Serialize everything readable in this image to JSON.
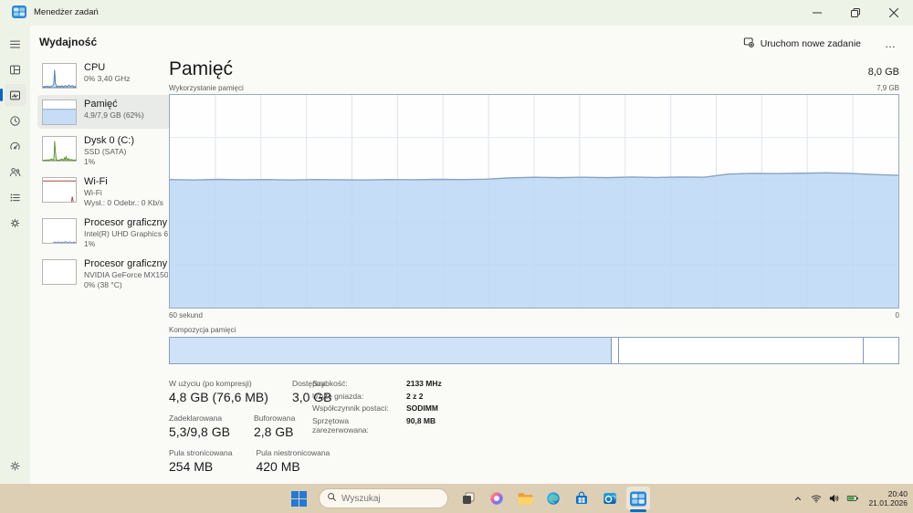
{
  "window": {
    "title": "Menedżer zadań"
  },
  "header": {
    "page_title": "Wydajność",
    "run_task_label": "Uruchom nowe zadanie",
    "more_label": "…"
  },
  "nav_rail": [
    "menu",
    "processes",
    "performance",
    "app-history",
    "startup-apps",
    "users",
    "details",
    "services",
    "settings"
  ],
  "sidebar": {
    "items": [
      {
        "name": "CPU",
        "line1": "0% 3,40 GHz"
      },
      {
        "name": "Pamięć",
        "line1": "4,9/7,9 GB (62%)",
        "selected": true
      },
      {
        "name": "Dysk 0 (C:)",
        "line1": "SSD (SATA)",
        "line2": "1%"
      },
      {
        "name": "Wi-Fi",
        "line1": "Wi-Fi",
        "line2": "Wysł.: 0 Odebr.: 0 Kb/s"
      },
      {
        "name": "Procesor graficzny",
        "line1": "Intel(R) UHD Graphics 6",
        "line2": "1%"
      },
      {
        "name": "Procesor graficzny",
        "line1": "NVIDIA GeForce MX150",
        "line2": "0% (38 °C)"
      }
    ]
  },
  "main": {
    "title": "Pamięć",
    "total": "8,0 GB",
    "chart_label": "Wykorzystanie pamięci",
    "chart_max": "7,9 GB",
    "time_label": "60 sekund",
    "time_zero": "0",
    "composition_label": "Kompozycja pamięci",
    "stats": [
      {
        "label": "W użyciu (po kompresji)",
        "value": "4,8 GB (76,6 MB)"
      },
      {
        "label": "Dostępna",
        "value": "3,0 GB"
      },
      {
        "label": "Zadeklarowana",
        "value": "5,3/9,8 GB"
      },
      {
        "label": "Buforowana",
        "value": "2,8 GB"
      },
      {
        "label": "Pula stronicowana",
        "value": "254 MB"
      },
      {
        "label": "Pula niestronicowana",
        "value": "420 MB"
      }
    ],
    "details": [
      {
        "label": "Szybkość:",
        "value": "2133 MHz"
      },
      {
        "label": "Użyte gniazda:",
        "value": "2 z 2"
      },
      {
        "label": "Współczynnik postaci:",
        "value": "SODIMM"
      },
      {
        "label": "Sprzętowa zarezerwowana:",
        "value": "90,8 MB"
      }
    ]
  },
  "chart_data": {
    "type": "area",
    "title": "Wykorzystanie pamięci",
    "x_axis": {
      "left_label": "60 sekund",
      "right_label": "0"
    },
    "y_axis": {
      "max_label": "7,9 GB",
      "range_percent": [
        0,
        100
      ]
    },
    "series_percent": [
      60.2,
      60.0,
      60.3,
      60.1,
      60.2,
      60.0,
      60.2,
      60.1,
      60.0,
      60.2,
      60.1,
      60.3,
      60.2,
      60.4,
      61.0,
      61.3,
      61.1,
      61.3,
      61.1,
      61.4,
      61.2,
      61.4,
      61.3,
      62.8,
      63.1,
      63.0,
      63.2,
      63.4,
      63.1,
      62.6,
      62.2
    ],
    "grid": {
      "vertical_divisions": 16,
      "horizontal_divisions": 5
    },
    "colors": {
      "fill": "#c3daf5",
      "line": "#8aa3c2",
      "border": "#97abc0",
      "accent": "#0067c0"
    },
    "composition_bar": {
      "label": "Kompozycja pamięci",
      "segments": [
        {
          "name": "in-use",
          "percent": 60.7
        },
        {
          "name": "modified",
          "percent": 0.9
        },
        {
          "name": "standby",
          "percent": 33.6
        },
        {
          "name": "free",
          "percent": 4.8
        }
      ]
    }
  },
  "taskbar": {
    "search_placeholder": "Wyszukaj",
    "apps": [
      "start",
      "search",
      "task-view",
      "copilot",
      "file-explorer",
      "edge",
      "store",
      "outlook",
      "task-manager"
    ],
    "active_app": "task-manager",
    "tray_icons": [
      "chevron-up",
      "wifi",
      "volume",
      "battery"
    ],
    "clock_time": "20:40",
    "clock_date": "21.01.2026"
  }
}
